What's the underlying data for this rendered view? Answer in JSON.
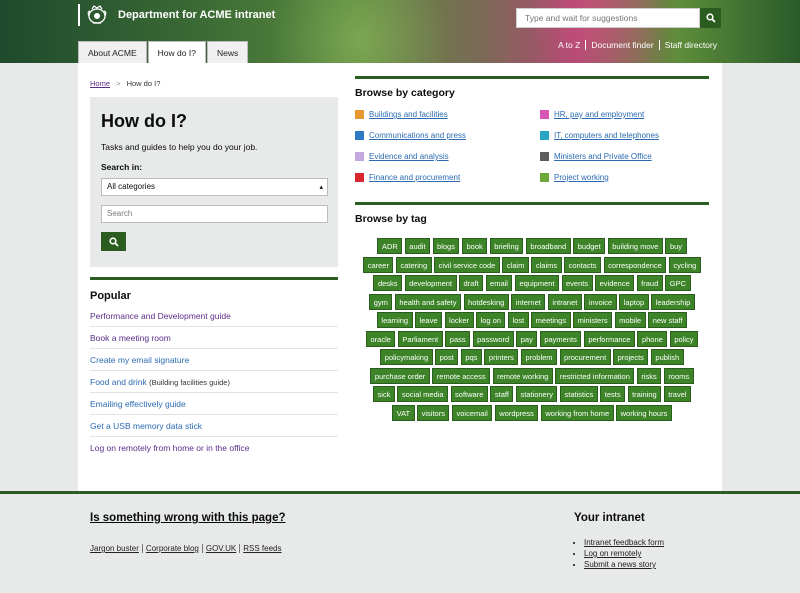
{
  "header": {
    "brand": "Department for ACME intranet",
    "search_placeholder": "Type and wait for suggestions",
    "tabs": [
      "About ACME",
      "How do I?",
      "News"
    ],
    "active_tab": "How do I?",
    "utility_links": [
      "A to Z",
      "Document finder",
      "Staff directory"
    ]
  },
  "breadcrumb": {
    "home": "Home",
    "separator": ">",
    "current": "How do I?"
  },
  "panel": {
    "title": "How do I?",
    "lead": "Tasks and guides to help you do your job.",
    "search_in_label": "Search in:",
    "category_select_value": "All categories",
    "search_placeholder": "Search"
  },
  "popular": {
    "heading": "Popular",
    "items": [
      {
        "label": "Performance and Development guide",
        "note": ""
      },
      {
        "label": "Book a meeting room",
        "note": ""
      },
      {
        "label": "Create my email signature",
        "note": ""
      },
      {
        "label": "Food and drink",
        "note": "(Building facilities guide)"
      },
      {
        "label": "Emailing effectively guide",
        "note": ""
      },
      {
        "label": "Get a USB memory data stick",
        "note": ""
      },
      {
        "label": "Log on remotely from home or in the office",
        "note": ""
      }
    ]
  },
  "categories": {
    "heading": "Browse by category",
    "items": [
      {
        "label": "Buildings and facilities",
        "color": "#e5982e"
      },
      {
        "label": "HR, pay and employment",
        "color": "#d957b4"
      },
      {
        "label": "Communications and press",
        "color": "#2f78c4"
      },
      {
        "label": "IT, computers and telephones",
        "color": "#28a5c2"
      },
      {
        "label": "Evidence and analysis",
        "color": "#c4a6e0"
      },
      {
        "label": "Ministers and Private Office",
        "color": "#5e5e5e"
      },
      {
        "label": "Finance and procurement",
        "color": "#d9262e"
      },
      {
        "label": "Project working",
        "color": "#6fa83a"
      }
    ]
  },
  "tags": {
    "heading": "Browse by tag",
    "items": [
      "ADR",
      "audit",
      "blogs",
      "book",
      "briefing",
      "broadband",
      "budget",
      "building move",
      "buy",
      "career",
      "catering",
      "civil service code",
      "claim",
      "claims",
      "contacts",
      "correspondence",
      "cycling",
      "desks",
      "development",
      "draft",
      "email",
      "equipment",
      "events",
      "evidence",
      "fraud",
      "GPC",
      "gym",
      "health and safety",
      "hotdesking",
      "internet",
      "intranet",
      "invoice",
      "laptop",
      "leadership",
      "learning",
      "leave",
      "locker",
      "log on",
      "lost",
      "meetings",
      "ministers",
      "mobile",
      "new staff",
      "oracle",
      "Parliament",
      "pass",
      "password",
      "pay",
      "payments",
      "performance",
      "phone",
      "policy",
      "policymaking",
      "post",
      "pqs",
      "printers",
      "problem",
      "procurement",
      "projects",
      "publish",
      "purchase order",
      "remote access",
      "remote working",
      "restricted information",
      "risks",
      "rooms",
      "sick",
      "social media",
      "software",
      "staff",
      "stationery",
      "statistics",
      "tests",
      "training",
      "travel",
      "VAT",
      "visitors",
      "voicemail",
      "wordpress",
      "working from home",
      "working hours"
    ]
  },
  "footer": {
    "question": "Is something wrong with this page?",
    "links": [
      "Jargon buster",
      "Corporate blog",
      "GOV.UK",
      "RSS feeds"
    ],
    "right_heading": "Your intranet",
    "right_links": [
      "Intranet feedback form",
      "Log on remotely",
      "Submit a news story"
    ]
  },
  "colors": {
    "brand_green": "#2a5d1f",
    "tag_green": "#3d8428",
    "link_purple": "#5a2d8a",
    "link_blue": "#2b6bb3"
  }
}
